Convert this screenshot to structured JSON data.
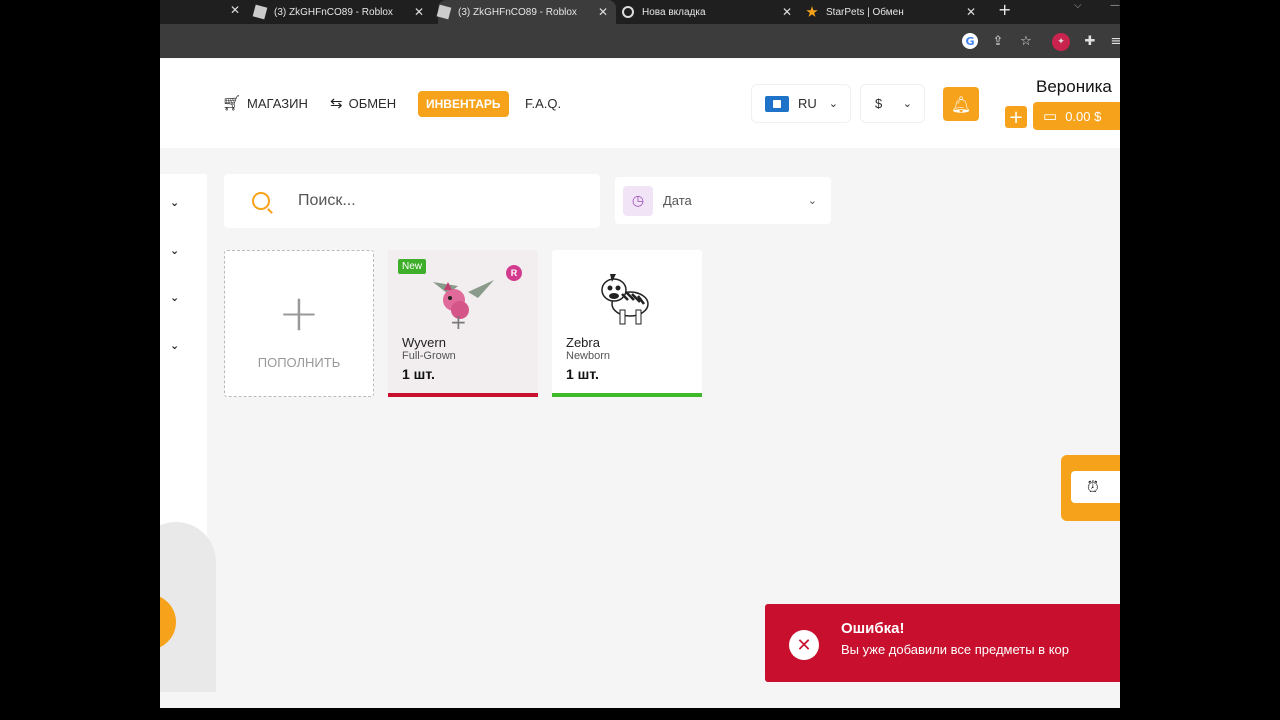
{
  "browser": {
    "tabs": [
      {
        "label": "(3) ZkGHFnCO89 - Roblox",
        "icon": "roblox-icon"
      },
      {
        "label": "(3) ZkGHFnCO89 - Roblox",
        "icon": "roblox-icon"
      },
      {
        "label": "Нова вкладка",
        "icon": "chrome-icon"
      },
      {
        "label": "StarPets | Обмен",
        "icon": "starpets-icon"
      }
    ],
    "close_glyph": "✕",
    "new_tab_glyph": "+"
  },
  "header": {
    "nav": [
      {
        "label": "МАГАЗИН",
        "icon": "cart-icon"
      },
      {
        "label": "ОБМЕН",
        "icon": "swap-icon"
      },
      {
        "label": "ИНВЕНТАРЬ",
        "active": true
      },
      {
        "label": "F.A.Q."
      }
    ],
    "language": "RU",
    "currency": "$",
    "username": "Вероника",
    "balance": "0.00 $",
    "accent_color": "#f7a21b"
  },
  "search": {
    "placeholder": "Поиск..."
  },
  "sort": {
    "selected": "Дата"
  },
  "inventory": {
    "add_card_label": "ПОПОЛНИТЬ",
    "items": [
      {
        "name": "Wyvern",
        "age": "Full-Grown",
        "qty": "1 шт.",
        "badge": "New",
        "rarity_badge": "R",
        "bar_color": "#c8102e"
      },
      {
        "name": "Zebra",
        "age": "Newborn",
        "qty": "1 шт.",
        "bar_color": "#3fb82a"
      }
    ]
  },
  "toast": {
    "title": "Ошибка!",
    "message": "Вы уже добавили все предметы в кор",
    "color": "#c8102e"
  }
}
